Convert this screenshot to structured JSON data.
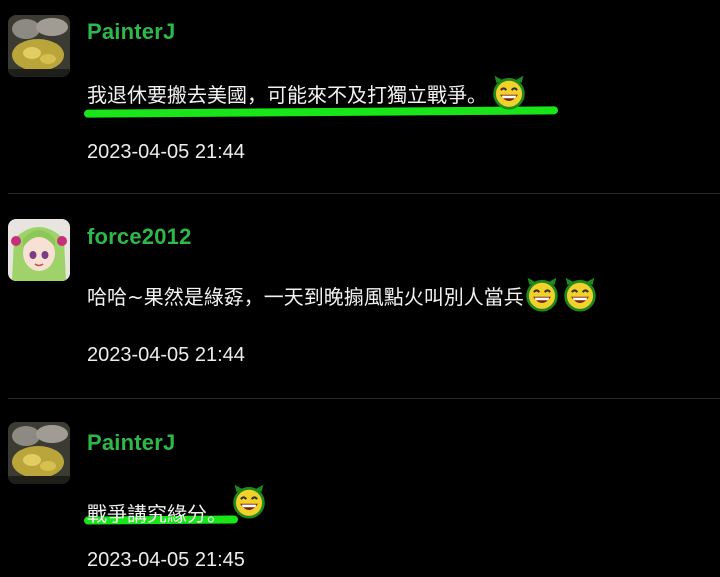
{
  "comments": [
    {
      "username": "PainterJ",
      "text": "我退休要搬去美國，可能來不及打獨立戰爭。",
      "emojis": [
        "grinning-devil-emoji"
      ],
      "timestamp": "2023-04-05 21:44",
      "avatar": "durian-avatar",
      "highlighted": true
    },
    {
      "username": "force2012",
      "text": "哈哈~果然是綠孬，一天到晚搧風點火叫別人當兵",
      "emojis": [
        "grinning-devil-emoji",
        "grinning-devil-emoji"
      ],
      "timestamp": "2023-04-05 21:44",
      "avatar": "anime-girl-avatar",
      "highlighted": false
    },
    {
      "username": "PainterJ",
      "text": "戰爭講究緣分。",
      "emojis": [
        "grinning-devil-emoji"
      ],
      "timestamp": "2023-04-05 21:45",
      "avatar": "durian-avatar",
      "highlighted": true
    }
  ],
  "colors": {
    "background": "#000000",
    "username": "#2fb84a",
    "highlight": "#19e619",
    "text": "#f2f2f2"
  }
}
